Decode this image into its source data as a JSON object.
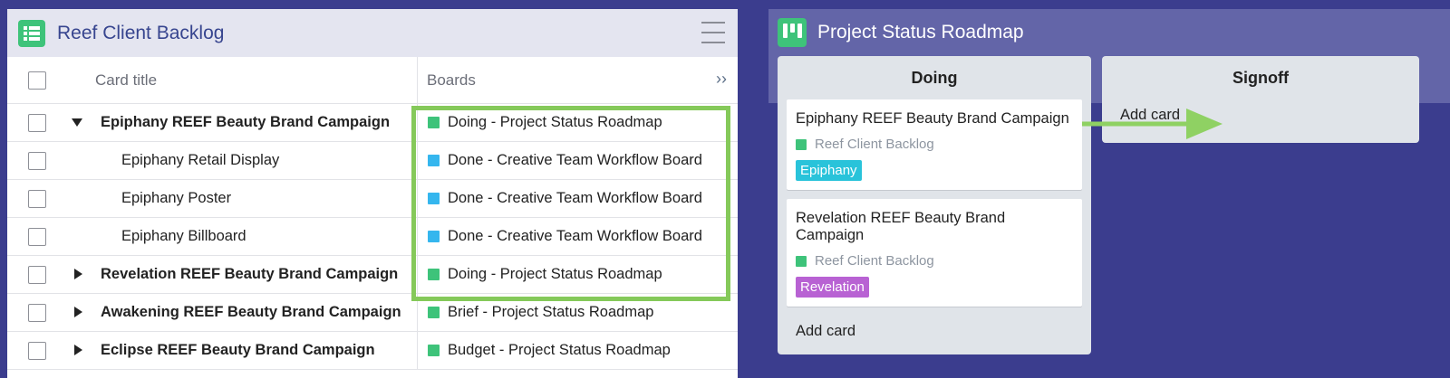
{
  "left": {
    "title": "Reef Client Backlog",
    "icon": "spreadsheet-icon",
    "columns": {
      "title": "Card title",
      "boards": "Boards",
      "expand": "››"
    },
    "rows": [
      {
        "title": "Epiphany REEF Beauty Brand Campaign",
        "level": "parent",
        "expanded": true,
        "board": "Doing - Project Status Roadmap",
        "color": "#3ec37a"
      },
      {
        "title": "Epiphany Retail Display",
        "level": "child",
        "board": "Done - Creative Team Workflow Board",
        "color": "#35b6ee"
      },
      {
        "title": "Epiphany Poster",
        "level": "child",
        "board": "Done - Creative Team Workflow Board",
        "color": "#35b6ee"
      },
      {
        "title": "Epiphany Billboard",
        "level": "child",
        "board": "Done - Creative Team Workflow Board",
        "color": "#35b6ee"
      },
      {
        "title": "Revelation REEF Beauty Brand Campaign",
        "level": "parent",
        "expanded": false,
        "board": "Doing - Project Status Roadmap",
        "color": "#3ec37a"
      },
      {
        "title": "Awakening REEF Beauty Brand Campaign",
        "level": "parent",
        "expanded": false,
        "board": "Brief - Project Status Roadmap",
        "color": "#3ec37a"
      },
      {
        "title": "Eclipse REEF Beauty Brand Campaign",
        "level": "parent",
        "expanded": false,
        "board": "Budget - Project Status Roadmap",
        "color": "#3ec37a"
      }
    ]
  },
  "right": {
    "title": "Project Status Roadmap",
    "icon": "trello-board-icon",
    "lists": {
      "doing": {
        "title": "Doing",
        "cards": [
          {
            "title": "Epiphany REEF Beauty Brand Campaign",
            "source": "Reef Client Backlog",
            "label": "Epiphany",
            "label_color": "#29c3da"
          },
          {
            "title": "Revelation REEF Beauty Brand Campaign",
            "source": "Reef Client Backlog",
            "label": "Revelation",
            "label_color": "#b862d3"
          }
        ],
        "add_card": "Add card"
      },
      "signoff": {
        "title": "Signoff",
        "add_card": "Add card"
      }
    }
  },
  "colors": {
    "background": "#3b3d8e",
    "highlight": "#85c95a",
    "arrow": "#8fd163",
    "board_green": "#3ec37a",
    "board_blue": "#35b6ee"
  }
}
